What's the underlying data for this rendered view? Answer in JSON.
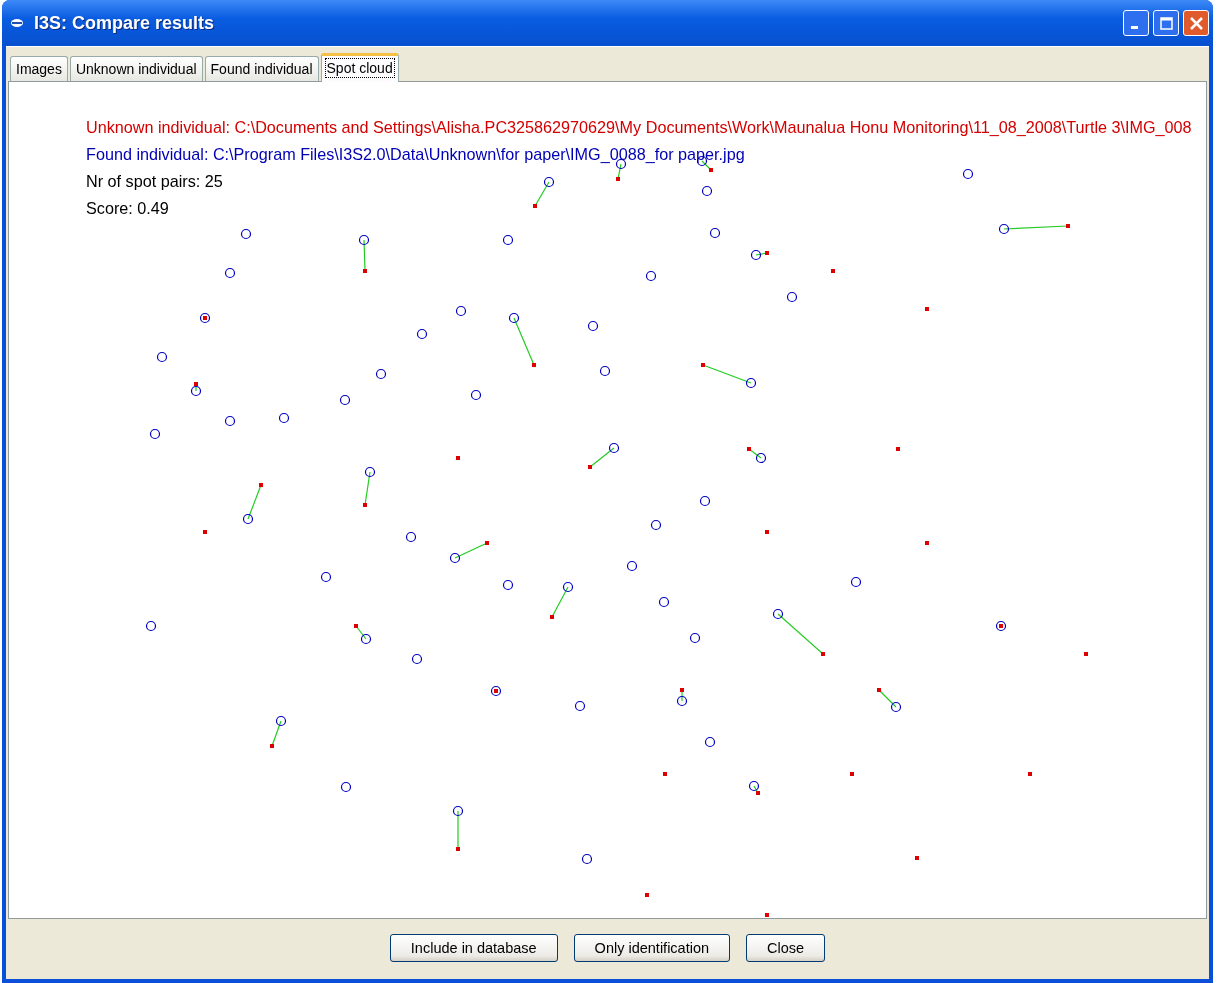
{
  "window": {
    "title": "I3S: Compare results"
  },
  "tabs": [
    {
      "label": "Images",
      "selected": false
    },
    {
      "label": "Unknown individual",
      "selected": false
    },
    {
      "label": "Found individual",
      "selected": false
    },
    {
      "label": "Spot cloud",
      "selected": true
    }
  ],
  "info_lines": [
    {
      "text": "Unknown individual: C:\\Documents and Settings\\Alisha.PC325862970629\\My Documents\\Work\\Maunalua Honu Monitoring\\11_08_2008\\Turtle 3\\IMG_008",
      "color": "#d40000"
    },
    {
      "text": "Found individual: C:\\Program Files\\I3S2.0\\Data\\Unknown\\for paper\\IMG_0088_for paper.jpg",
      "color": "#0000b4"
    },
    {
      "text": "Nr of spot pairs: 25",
      "color": "#000000"
    },
    {
      "text": "Score: 0.49",
      "color": "#000000"
    }
  ],
  "buttons": [
    "Include in database",
    "Only identification",
    "Close"
  ]
}
